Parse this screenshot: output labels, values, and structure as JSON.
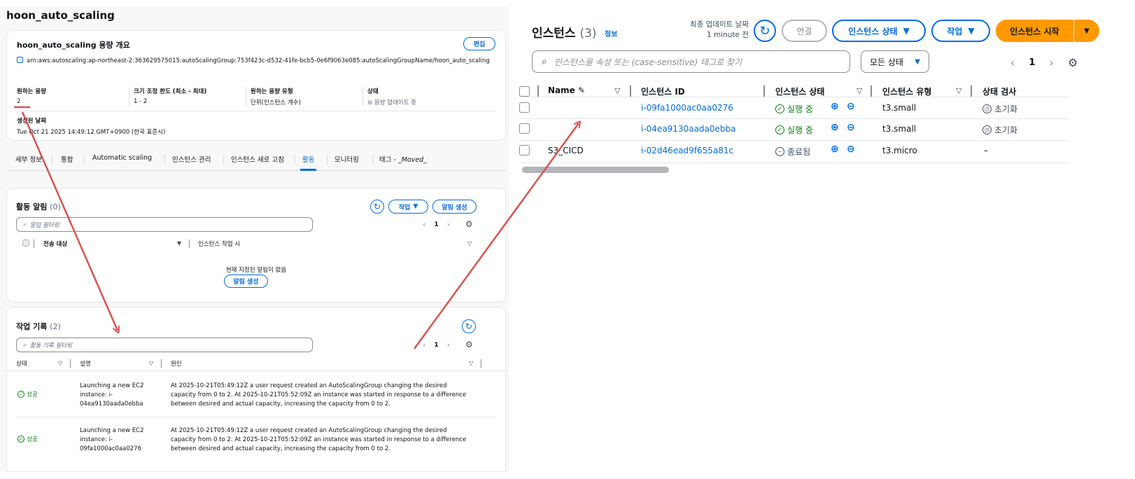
{
  "left": {
    "asg_title": "hoon_auto_scaling",
    "overview": {
      "heading": "hoon_auto_scaling 용량 개요",
      "edit_label": "편집",
      "arn": "arn:aws:autoscaling:ap-northeast-2:363629575015:autoScalingGroup:753f423c-d532-41fe-bcb5-0e6f9063e085:autoScalingGroupName/hoon_auto_scaling",
      "desired_capacity": {
        "label": "원하는 용량",
        "value": "2"
      },
      "size_limits": {
        "label": "크기 조정 한도 (최소 - 최대)",
        "value": "1 - 2"
      },
      "capacity_type": {
        "label": "원하는 용량 유형",
        "value": "단위(인스턴스 개수)"
      },
      "status": {
        "label": "상태",
        "value": "용량 업데이트 중"
      },
      "created": {
        "label": "생성된 날짜",
        "value": "Tue Oct 21 2025 14:49:12 GMT+0900 (한국 표준시)"
      }
    },
    "tabs": [
      {
        "label": "세부 정보"
      },
      {
        "label": "통합"
      },
      {
        "label": "Automatic scaling"
      },
      {
        "label": "인스턴스 관리"
      },
      {
        "label": "인스턴스 새로 고침"
      },
      {
        "label": "활동"
      },
      {
        "label": "모니터링"
      },
      {
        "label_prefix": "태그 - ",
        "label_italic": "_Moved_"
      }
    ],
    "alerts": {
      "title": "활동 알림",
      "count": "(0)",
      "action_label": "작업",
      "create_label": "알림 생성",
      "search_placeholder": "알림 필터링",
      "page": "1",
      "col_target": "전송 대상",
      "col_action": "인스턴스 작업 시",
      "empty_message": "현재 지정된 알림이 없음",
      "empty_create_label": "알림 생성"
    },
    "history": {
      "title": "작업 기록",
      "count": "(2)",
      "search_placeholder": "활동 기록 필터링",
      "page": "1",
      "col_status": "상태",
      "col_desc": "설명",
      "col_cause": "원인",
      "rows": [
        {
          "status": "성공",
          "desc": "Launching a new EC2 instance: i-04ea9130aada0ebba",
          "cause": "At 2025-10-21T05:49:12Z a user request created an AutoScalingGroup changing the desired capacity from 0 to 2. At 2025-10-21T05:52:09Z an instance was started in response to a difference between desired and actual capacity, increasing the capacity from 0 to 2."
        },
        {
          "status": "성공",
          "desc": "Launching a new EC2 instance: i-09fa1000ac0aa0276",
          "cause": "At 2025-10-21T05:49:12Z a user request created an AutoScalingGroup changing the desired capacity from 0 to 2. At 2025-10-21T05:52:09Z an instance was started in response to a difference between desired and actual capacity, increasing the capacity from 0 to 2."
        }
      ]
    }
  },
  "right": {
    "title": "인스턴스",
    "count": "(3)",
    "info_label": "정보",
    "last_update_label": "최종 업데이트 날짜",
    "last_update_value": "1 minute 전",
    "connect_label": "연결",
    "instance_state_label": "인스턴스 상태",
    "actions_label": "작업",
    "launch_label": "인스턴스 시작",
    "search_placeholder": "인스턴스을 속성 또는 (case-sensitive) 태그로 찾기",
    "state_filter": "모든 상태",
    "page": "1",
    "columns": {
      "name": "Name",
      "id": "인스턴스 ID",
      "state": "인스턴스 상태",
      "type": "인스턴스 유형",
      "check": "상태 검사"
    },
    "rows": [
      {
        "name": "",
        "id": "i-09fa1000ac0aa0276",
        "state": "실행 중",
        "state_kind": "running",
        "type": "t3.small",
        "check": "초기화"
      },
      {
        "name": "",
        "id": "i-04ea9130aada0ebba",
        "state": "실행 중",
        "state_kind": "running",
        "type": "t3.small",
        "check": "초기화"
      },
      {
        "name": "S3_CICD",
        "id": "i-02d46ead9f655a81c",
        "state": "종료됨",
        "state_kind": "terminated",
        "type": "t3.micro",
        "check": "–"
      }
    ]
  },
  "colors": {
    "link": "#006ce0",
    "success": "#037f0c",
    "primary_button": "#ff9900",
    "annotation_arrow": "#d9534f"
  }
}
